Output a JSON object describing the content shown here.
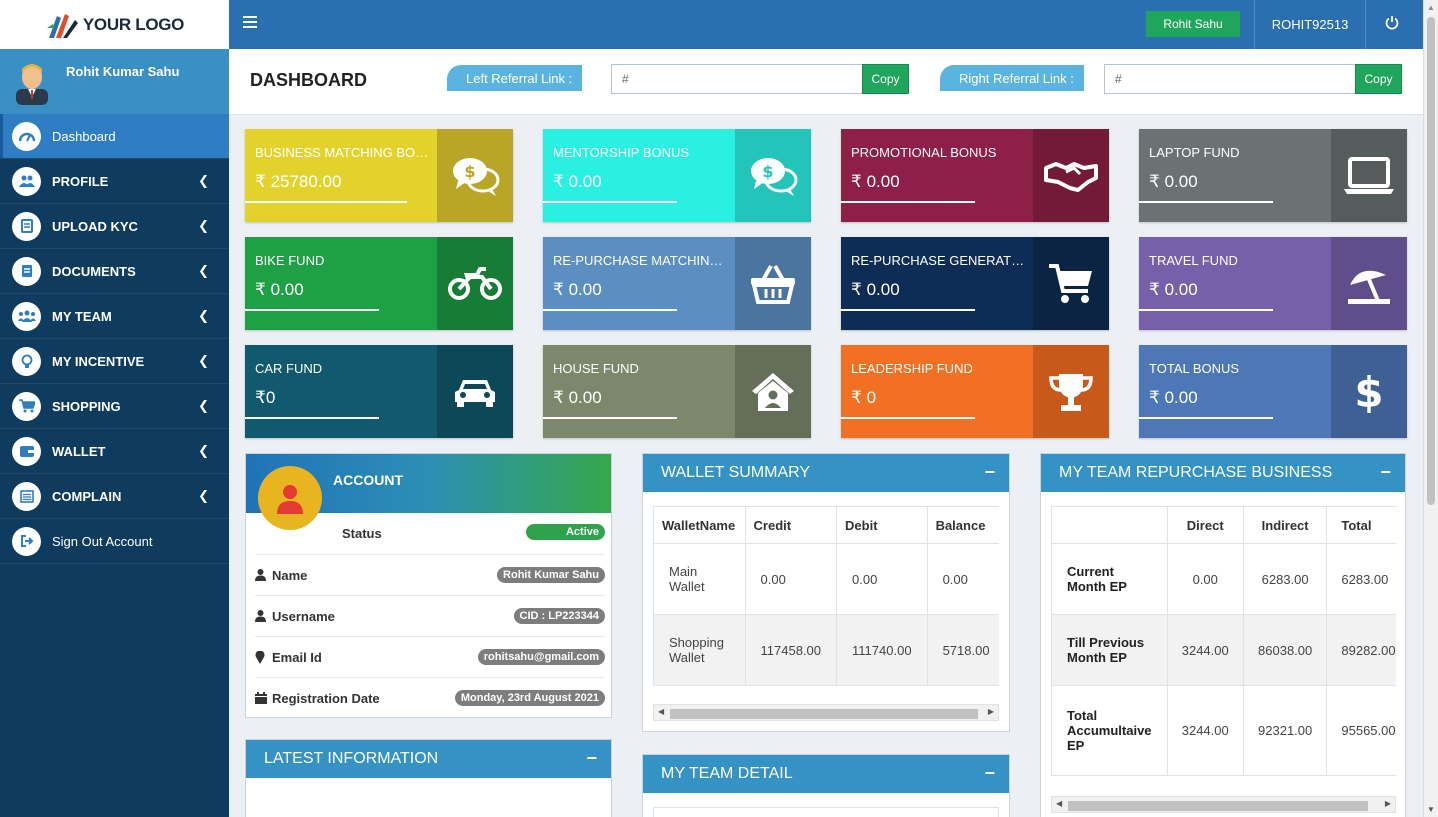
{
  "brand": {
    "logo_text": "YOUR LOGO"
  },
  "user": {
    "full_name": "Rohit Kumar Sahu",
    "top_name": "Rohit Sahu",
    "user_id": "ROHIT92513"
  },
  "sidebar": {
    "items": [
      {
        "label": "Dashboard",
        "icon": "dashboard-icon",
        "active": true
      },
      {
        "label": "PROFILE",
        "icon": "users-icon"
      },
      {
        "label": "UPLOAD KYC",
        "icon": "file-icon"
      },
      {
        "label": "DOCUMENTS",
        "icon": "document-icon"
      },
      {
        "label": "MY TEAM",
        "icon": "team-icon"
      },
      {
        "label": "MY INCENTIVE",
        "icon": "lightbulb-icon"
      },
      {
        "label": "SHOPPING",
        "icon": "cart-icon"
      },
      {
        "label": "WALLET",
        "icon": "wallet-icon"
      },
      {
        "label": "COMPLAIN",
        "icon": "list-icon"
      },
      {
        "label": "Sign Out Account",
        "icon": "signout-icon"
      }
    ]
  },
  "header": {
    "title": "DASHBOARD",
    "left_ref_label": "Left Referral Link :",
    "left_ref_value": "#",
    "right_ref_label": "Right Referral Link :",
    "right_ref_value": "#",
    "copy_label": "Copy"
  },
  "cards": [
    {
      "title": "BUSINESS MATCHING BONUS",
      "value": "25780.00",
      "color": "#e3d22c",
      "icon_bg": "#b9a626",
      "icon": "chat-dollar-icon"
    },
    {
      "title": "MENTORSHIP BONUS",
      "value": "0.00",
      "color": "#2af0e2",
      "icon_bg": "#23c4b9",
      "icon": "chat-dollar-icon"
    },
    {
      "title": "PROMOTIONAL BONUS",
      "value": "0.00",
      "color": "#8e1f46",
      "icon_bg": "#741a39",
      "icon": "handshake-icon"
    },
    {
      "title": "LAPTOP FUND",
      "value": "0.00",
      "color": "#6c7273",
      "icon_bg": "#565b5c",
      "icon": "laptop-icon"
    },
    {
      "title": "BIKE FUND",
      "value": "0.00",
      "color": "#1ea044",
      "icon_bg": "#177c35",
      "icon": "motorcycle-icon"
    },
    {
      "title": "RE-PURCHASE MATCHING BONUS",
      "value": "0.00",
      "color": "#5b8fc1",
      "icon_bg": "#4a759e",
      "icon": "basket-icon"
    },
    {
      "title": "RE-PURCHASE GENERATION BONUS",
      "value": "0.00",
      "color": "#0e2d56",
      "icon_bg": "#0b2444",
      "icon": "cart-icon"
    },
    {
      "title": "TRAVEL FUND",
      "value": "0.00",
      "color": "#7560a9",
      "icon_bg": "#5f4e89",
      "icon": "umbrella-beach-icon"
    },
    {
      "title": "CAR FUND",
      "value": "0",
      "color": "#10596e",
      "icon_bg": "#0d4858",
      "icon": "car-icon"
    },
    {
      "title": "HOUSE FUND",
      "value": "0.00",
      "color": "#7c876c",
      "icon_bg": "#656e58",
      "icon": "house-user-icon"
    },
    {
      "title": "LEADERSHIP FUND",
      "value": "0",
      "color": "#f27024",
      "icon_bg": "#c75a1b",
      "icon": "trophy-icon"
    },
    {
      "title": "TOTAL BONUS",
      "value": "0.00",
      "color": "#4e77b7",
      "icon_bg": "#3e6095",
      "icon": "dollar-icon"
    }
  ],
  "currency_symbol": "₹",
  "account": {
    "title": "ACCOUNT",
    "status_label": "Status",
    "status_value": "Active",
    "name_label": "Name",
    "name_value": "Rohit Kumar Sahu",
    "username_label": "Username",
    "username_value": "CID : LP223344",
    "email_label": "Email Id",
    "email_value": "rohitsahu@gmail.com",
    "reg_label": "Registration Date",
    "reg_value": "Monday, 23rd August 2021"
  },
  "latest_info": {
    "title": "LATEST INFORMATION",
    "min": "−"
  },
  "wallet_summary": {
    "title": "WALLET SUMMARY",
    "min": "−",
    "headers": [
      "WalletName",
      "Credit",
      "Debit",
      "Balance"
    ],
    "rows": [
      {
        "name1": "Main",
        "name2": "Wallet",
        "credit": "0.00",
        "debit": "0.00",
        "balance": "0.00"
      },
      {
        "name1": "Shopping",
        "name2": "Wallet",
        "credit": "117458.00",
        "debit": "111740.00",
        "balance": "5718.00"
      }
    ]
  },
  "team_detail": {
    "title": "MY TEAM DETAIL",
    "min": "−"
  },
  "repurchase": {
    "title": "MY TEAM REPURCHASE BUSINESS",
    "min": "−",
    "headers": [
      "",
      "Direct",
      "Indirect",
      "Total"
    ],
    "rows": [
      {
        "l1": "Current",
        "l2": "Month EP",
        "l3": "",
        "direct": "0.00",
        "indirect": "6283.00",
        "total": "6283.00"
      },
      {
        "l1": "Till Previous",
        "l2": "Month EP",
        "l3": "",
        "direct": "3244.00",
        "indirect": "86038.00",
        "total": "89282.00"
      },
      {
        "l1": "Total",
        "l2": "Accumultaive",
        "l3": "EP",
        "direct": "3244.00",
        "indirect": "92321.00",
        "total": "95565.00"
      }
    ]
  }
}
